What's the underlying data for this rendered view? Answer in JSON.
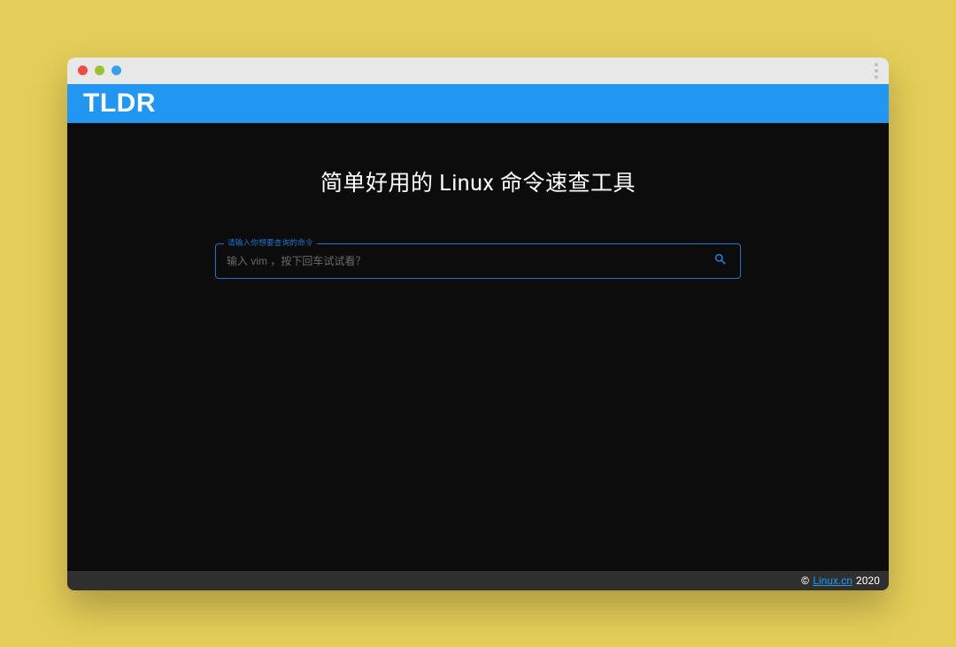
{
  "header": {
    "logo": "TLDR"
  },
  "main": {
    "hero_title": "简单好用的 Linux 命令速查工具",
    "search": {
      "legend": "请输入你想要查询的命令",
      "placeholder": "输入 vim ，按下回车试试看？"
    }
  },
  "footer": {
    "copyright_symbol": "©",
    "link_text": "Linux.cn",
    "year": "2020"
  }
}
